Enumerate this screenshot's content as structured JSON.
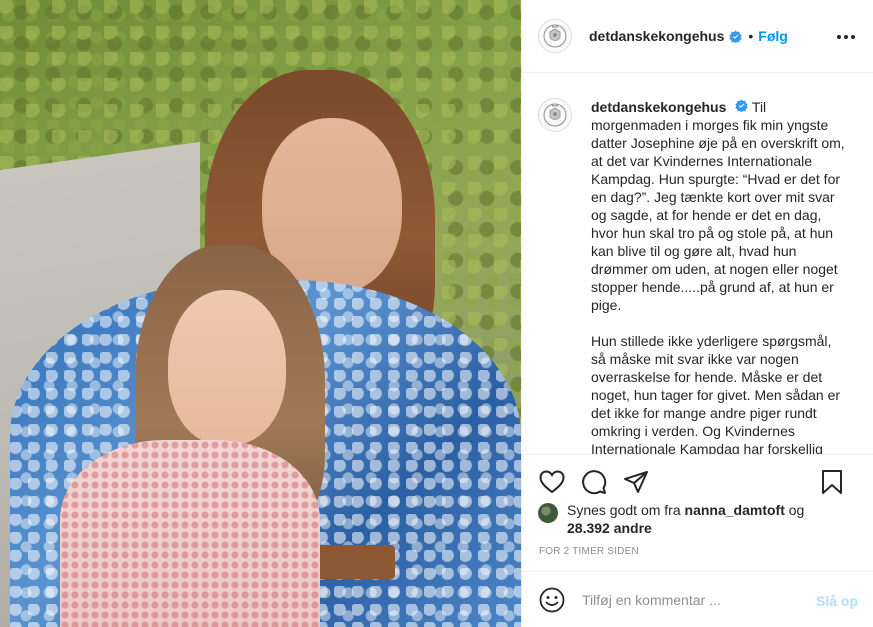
{
  "header": {
    "username": "detdanskekongehus",
    "separator": "•",
    "follow_label": "Følg"
  },
  "caption": {
    "username": "detdanskekongehus",
    "text": "Til morgenmaden i morges fik min yngste datter Josephine øje på en overskrift om, at det var Kvindernes Internationale Kampdag. Hun spurgte: “Hvad er det for en dag?”. Jeg tænkte kort over mit svar og sagde, at for hende er det en dag, hvor hun skal tro på og stole på, at hun kan blive til og gøre alt, hvad hun drømmer om uden, at nogen eller noget stopper hende.....på grund af, at hun er pige.\n\nHun stillede ikke yderligere spørgsmål, så måske mit svar ikke var nogen overraskelse for hende. Måske er det noget, hun tager for givet. Men sådan er det ikke for mange andre piger rundt omkring i verden. Og Kvindernes Internationale Kampdag har forskellig"
  },
  "likes": {
    "prefix": "Synes godt om fra",
    "liker": "nanna_damtoft",
    "conjunction": "og",
    "others": "28.392 andre"
  },
  "timestamp": "FOR 2 TIMER SIDEN",
  "comment": {
    "placeholder": "Tilføj en kommentar ...",
    "post_label": "Slå op"
  },
  "colors": {
    "accent": "#0095f6",
    "post_disabled": "#b2dffc",
    "text": "#262626",
    "muted": "#8e8e8e"
  },
  "icons": [
    "crest-icon",
    "verified-badge-icon",
    "more-icon",
    "heart-icon",
    "comment-icon",
    "share-icon",
    "bookmark-icon",
    "emoji-icon"
  ]
}
